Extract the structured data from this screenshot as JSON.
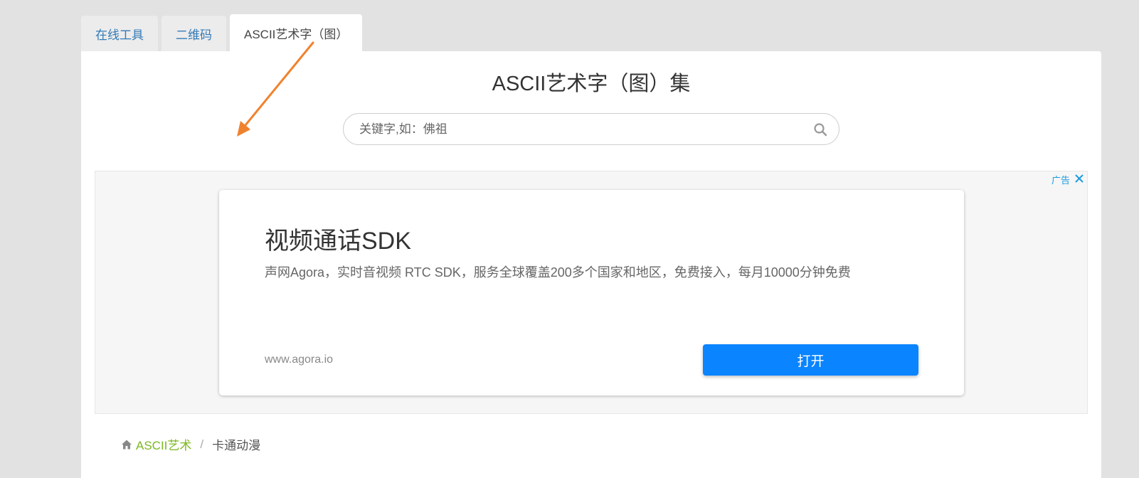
{
  "tabs": [
    {
      "label": "在线工具",
      "active": false
    },
    {
      "label": "二维码",
      "active": false
    },
    {
      "label": "ASCII艺术字（图）",
      "active": true
    }
  ],
  "page": {
    "title": "ASCII艺术字（图）集"
  },
  "search": {
    "placeholder": "关键字,如：佛祖",
    "value": "",
    "icon": "search-icon"
  },
  "ad": {
    "label": "广告",
    "close_icon": "close-icon",
    "title": "视频通话SDK",
    "description": "声网Agora，实时音视频 RTC SDK，服务全球覆盖200多个国家和地区，免费接入，每月10000分钟免费",
    "domain": "www.agora.io",
    "open_label": "打开",
    "button_color": "#0a84ff"
  },
  "breadcrumb": {
    "home_icon": "home-icon",
    "root": "ASCII艺术",
    "separator": "/",
    "current": "卡通动漫"
  },
  "colors": {
    "tab_link": "#337ab7",
    "breadcrumb_link": "#7cb821",
    "ad_label": "#1a9be0",
    "annotation_arrow": "#f0822e"
  }
}
